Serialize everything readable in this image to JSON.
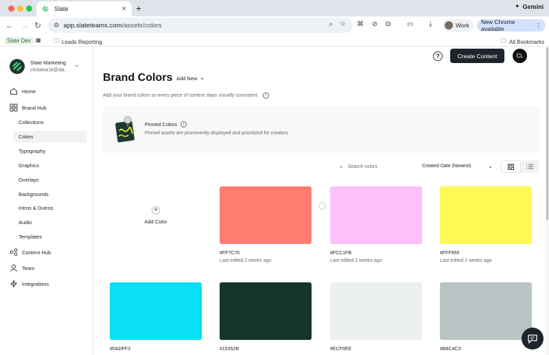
{
  "browser": {
    "tab_title": "Slate",
    "gemini_label": "Gemini",
    "url_host": "app.slateteams.com",
    "url_path": "/assets/colors",
    "profile_label": "Work",
    "update_label": "New Chrome available",
    "bookmarks": {
      "dev_badge": "Slate Dev",
      "leads": "Leads Reporting",
      "all": "All Bookmarks"
    }
  },
  "sidebar": {
    "workspace_name": "Slate Marketing",
    "workspace_email": "christina.le@sla...",
    "items": [
      {
        "label": "Home",
        "icon": "home-icon"
      },
      {
        "label": "Brand Hub",
        "icon": "brand-hub-icon"
      },
      {
        "label": "Content Hub",
        "icon": "content-hub-icon"
      },
      {
        "label": "Team",
        "icon": "team-icon"
      },
      {
        "label": "Integrations",
        "icon": "integrations-icon"
      }
    ],
    "brand_hub_sub": [
      {
        "label": "Collections"
      },
      {
        "label": "Colors"
      },
      {
        "label": "Typography"
      },
      {
        "label": "Graphics"
      },
      {
        "label": "Overlays"
      },
      {
        "label": "Backgrounds"
      },
      {
        "label": "Intros & Outros"
      },
      {
        "label": "Audio"
      },
      {
        "label": "Templates"
      }
    ]
  },
  "header": {
    "help_icon": "?",
    "create_button": "Create Content",
    "avatar_initials": "CL"
  },
  "page": {
    "title": "Brand Colors",
    "add_new": "Add New",
    "subtitle": "Add your brand colors so every piece of content stays visually consistent.",
    "pinned_title": "Pinned Colors",
    "pinned_desc": "Pinned assets are prominently displayed and prioritized for creators",
    "search_placeholder": "Search colors",
    "sort_value": "Created Date (Newest)",
    "add_color_label": "Add Color"
  },
  "colors": [
    {
      "hex": "#FF7C70",
      "edited": "Last edited 2 weeks ago"
    },
    {
      "hex": "#FCC1FB",
      "edited": "Last edited 2 weeks ago"
    },
    {
      "hex": "#FFF955",
      "edited": "Last edited 2 weeks ago"
    },
    {
      "hex": "#0ADFF3",
      "edited": ""
    },
    {
      "hex": "#15352B",
      "edited": ""
    },
    {
      "hex": "#ECF0EE",
      "edited": ""
    },
    {
      "hex": "#B8C4C3",
      "edited": ""
    }
  ],
  "theme": {
    "accent_dark": "#1f232b",
    "brand_green": "#1d3a2e",
    "logo_green": "#4ade80"
  }
}
